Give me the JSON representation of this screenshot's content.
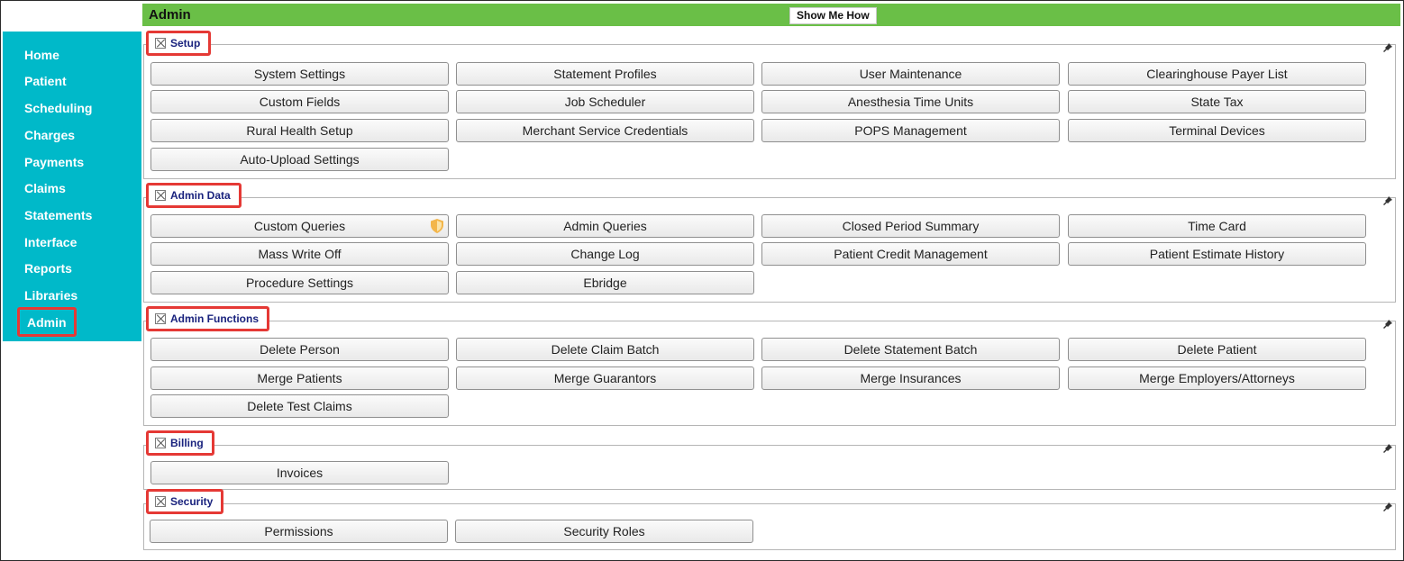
{
  "header": {
    "title": "Admin",
    "show_me_how": "Show Me How"
  },
  "nav": {
    "items": [
      "Home",
      "Patient",
      "Scheduling",
      "Charges",
      "Payments",
      "Claims",
      "Statements",
      "Interface",
      "Reports",
      "Libraries",
      "Admin"
    ],
    "active": "Admin"
  },
  "sections": {
    "setup": {
      "title": "Setup",
      "buttons": [
        "System Settings",
        "Statement Profiles",
        "User Maintenance",
        "Clearinghouse Payer List",
        "Custom Fields",
        "Job Scheduler",
        "Anesthesia Time Units",
        "State Tax",
        "Rural Health Setup",
        "Merchant Service Credentials",
        "POPS Management",
        "Terminal Devices",
        "Auto-Upload Settings"
      ]
    },
    "admin_data": {
      "title": "Admin Data",
      "buttons": [
        "Custom Queries",
        "Admin Queries",
        "Closed Period Summary",
        "Time Card",
        "Mass Write Off",
        "Change Log",
        "Patient Credit Management",
        "Patient Estimate History",
        "Procedure Settings",
        "Ebridge"
      ]
    },
    "admin_functions": {
      "title": "Admin Functions",
      "buttons": [
        "Delete Person",
        "Delete Claim Batch",
        "Delete Statement Batch",
        "Delete Patient",
        "Merge Patients",
        "Merge Guarantors",
        "Merge Insurances",
        "Merge Employers/Attorneys",
        "Delete Test Claims"
      ]
    },
    "billing": {
      "title": "Billing",
      "buttons": [
        "Invoices"
      ]
    },
    "security": {
      "title": "Security",
      "buttons": [
        "Permissions",
        "Security Roles"
      ]
    }
  },
  "colors": {
    "header_bg": "#6abf47",
    "sidebar_bg": "#00b9c9",
    "highlight": "#e53935",
    "section_title": "#1a237e"
  },
  "icons": {
    "section_toggle": "checkbox-x-icon",
    "section_pin": "pin-icon",
    "custom_queries_badge": "shield-icon"
  }
}
